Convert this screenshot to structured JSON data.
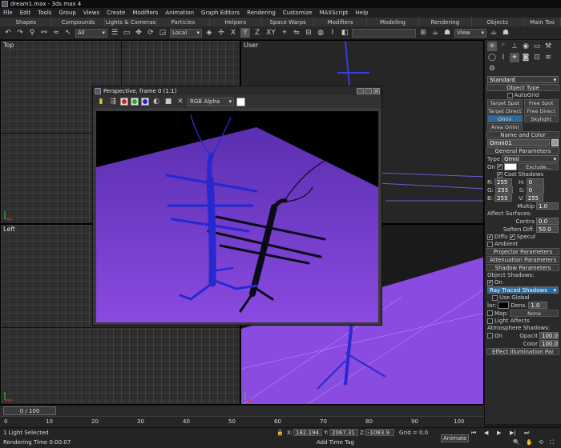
{
  "window": {
    "title": "dream1.max - 3ds max 4"
  },
  "menu": [
    "File",
    "Edit",
    "Tools",
    "Group",
    "Views",
    "Create",
    "Modifiers",
    "Animation",
    "Graph Editors",
    "Rendering",
    "Customize",
    "MAXScript",
    "Help"
  ],
  "tabs": [
    "Shapes",
    "Compounds",
    "Lights & Cameras",
    "Particles",
    "Helpers",
    "Space Warps",
    "Modifiers",
    "Modeling",
    "Rendering",
    "Objects",
    "Main Too"
  ],
  "toolbar": {
    "selection_filter": "All",
    "ref_coord": "Local",
    "axis_buttons": [
      "X",
      "Y",
      "Z",
      "XY"
    ],
    "view_dropdown": "View"
  },
  "viewports": {
    "top": "Top",
    "user": "User",
    "left": "Left"
  },
  "render_window": {
    "title": "Perspective, frame 0 (1:1)",
    "channel": "RGB Alpha"
  },
  "command_panel": {
    "category": "Standard",
    "object_type": {
      "header": "Object Type",
      "autogrid": "AutoGrid",
      "buttons": [
        "Target Spot",
        "Free Spot",
        "Target Direct",
        "Free Direct",
        "Omni",
        "Skylight",
        "Area Omni"
      ]
    },
    "name_color": {
      "header": "Name and Color",
      "name": "Omni01"
    },
    "general": {
      "header": "General Parameters",
      "type_label": "Type",
      "type_value": "Omni",
      "on_label": "On",
      "exclude_label": "Exclude...",
      "cast_shadows": "Cast Shadows",
      "r": "255",
      "g": "255",
      "b": "255",
      "h": "0",
      "s": "0",
      "v": "255",
      "multiplier_label": "Multip",
      "multiplier": "1.0",
      "affect_surfaces": "Affect Surfaces:",
      "contrast_label": "Contra",
      "contrast": "0.0",
      "soften_label": "Soften Diff.",
      "soften": "50.0",
      "diffuse": "Diffu",
      "specular": "Specul",
      "ambient": "Ambient"
    },
    "projector": "Projector Parameters",
    "attenuation": "Attenuation Parameters",
    "shadow": {
      "header": "Shadow Parameters",
      "object_shadows": "Object Shadows:",
      "on": "On",
      "type": "Ray Traced Shadows",
      "use_global": "Use Global",
      "color_label": "lor:",
      "dens_label": "Dens.",
      "dens": "1.0",
      "map_label": "Map:",
      "map_value": "None",
      "light_affects": "Light Affects",
      "atmosphere": "Atmosphere Shadows:",
      "atm_on": "On",
      "opacity_label": "Opacit",
      "opacity": "100.0",
      "color_amount_label": "Color",
      "color_amount": "100.0"
    },
    "effects": "Effect Illumination Par"
  },
  "timeline": {
    "frame": "0 / 100",
    "ticks": [
      "0",
      "10",
      "20",
      "30",
      "40",
      "50",
      "60",
      "70",
      "80",
      "90",
      "100"
    ]
  },
  "status": {
    "selection": "1 Light Selected",
    "render_time": "Rendering Time  0:00:07",
    "x": "182.194",
    "y": "2067.31",
    "z": "-1083.9",
    "grid": "Grid = 0.0",
    "add_time_tag": "Add Time Tag",
    "animate": "Animate"
  },
  "colors": {
    "render_floor": "#7a3fd2",
    "insect": "#2a2ad0"
  }
}
